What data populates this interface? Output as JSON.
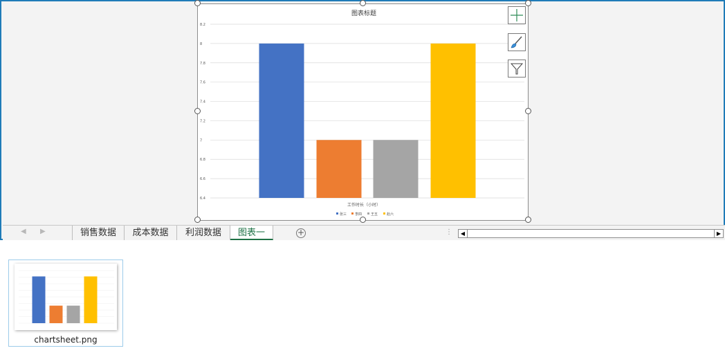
{
  "chart_data": {
    "type": "bar",
    "title": "图表标题",
    "xlabel": "工作时长（小时）",
    "ylabel": "",
    "categories": [
      "张三",
      "李四",
      "王五",
      "赵六"
    ],
    "values": [
      8,
      7,
      7,
      8
    ],
    "colors": [
      "#4472c4",
      "#ed7d31",
      "#a5a5a5",
      "#ffc000"
    ],
    "ylim": [
      6.4,
      8.2
    ],
    "yticks": [
      8.2,
      8,
      7.8,
      7.6,
      7.4,
      7.2,
      7,
      6.8,
      6.6,
      6.4
    ],
    "grid": true,
    "legend_position": "bottom"
  },
  "chart_tools": {
    "elements_icon": "plus-icon",
    "styles_icon": "paintbrush-icon",
    "filters_icon": "funnel-icon"
  },
  "sheet_tabs": [
    {
      "label": "销售数据",
      "active": false
    },
    {
      "label": "成本数据",
      "active": false
    },
    {
      "label": "利润数据",
      "active": false
    },
    {
      "label": "图表一",
      "active": true
    }
  ],
  "thumbnail": {
    "caption": "chartsheet.png"
  },
  "colors": {
    "window_border": "#1f7bb8",
    "active_tab": "#1e7145"
  }
}
